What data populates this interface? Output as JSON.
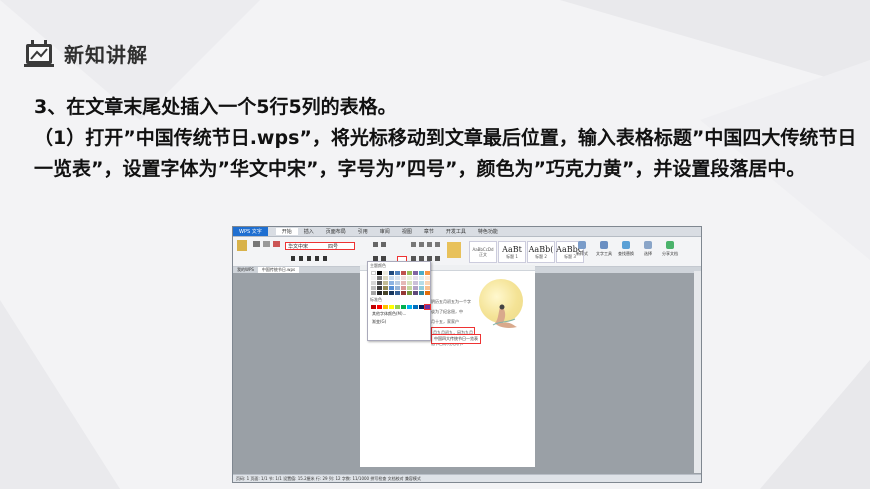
{
  "slide": {
    "header": "新知讲解",
    "heading": "3、在文章末尾处插入一个5行5列的表格。",
    "paragraph": "（1）打开”中国传统节日.wps”，将光标移动到文章最后位置，输入表格标题”中国四大传统节日一览表”，设置字体为”华文中宋”，字号为”四号”，颜色为”巧克力黄”，并设置段落居中。"
  },
  "screenshot": {
    "app_button": "WPS 文字",
    "menu_tabs": [
      "开始",
      "插入",
      "页面布局",
      "引用",
      "审阅",
      "视图",
      "章节",
      "开发工具",
      "特色功能"
    ],
    "font_name": "华文中宋",
    "font_size": "四号",
    "styles": [
      {
        "sample": "AaBbCcDd",
        "name": "正文"
      },
      {
        "sample": "AaBt",
        "name": "标题 1"
      },
      {
        "sample": "AaBb(",
        "name": "标题 2"
      },
      {
        "sample": "AaBbC",
        "name": "标题 3"
      }
    ],
    "right_tools": [
      "新样式",
      "文字工具",
      "查找替换",
      "选择",
      "分享文档"
    ],
    "doc_tabs": [
      "我的WPS",
      "中国传统节日.wps"
    ],
    "palette": {
      "theme_label": "主题颜色",
      "standard_label": "标准色",
      "more_colors": "其他字体颜色(M)...",
      "gradient": "渐变(G)"
    },
    "doc_lines": [
      "阴历五月初五为一个字",
      "谈为了纪念屈，中",
      "月十五，家家户",
      "月九月初九，因为九月",
      "俗节日称为九月节"
    ],
    "table_title": "中国四大传统节日一览表",
    "status": "页码: 1  页面: 1/1  节: 1/1  设置值: 15.2厘米  行: 29  列: 12  字数: 11/1000  拼写检查  文档校对  兼容模式"
  }
}
